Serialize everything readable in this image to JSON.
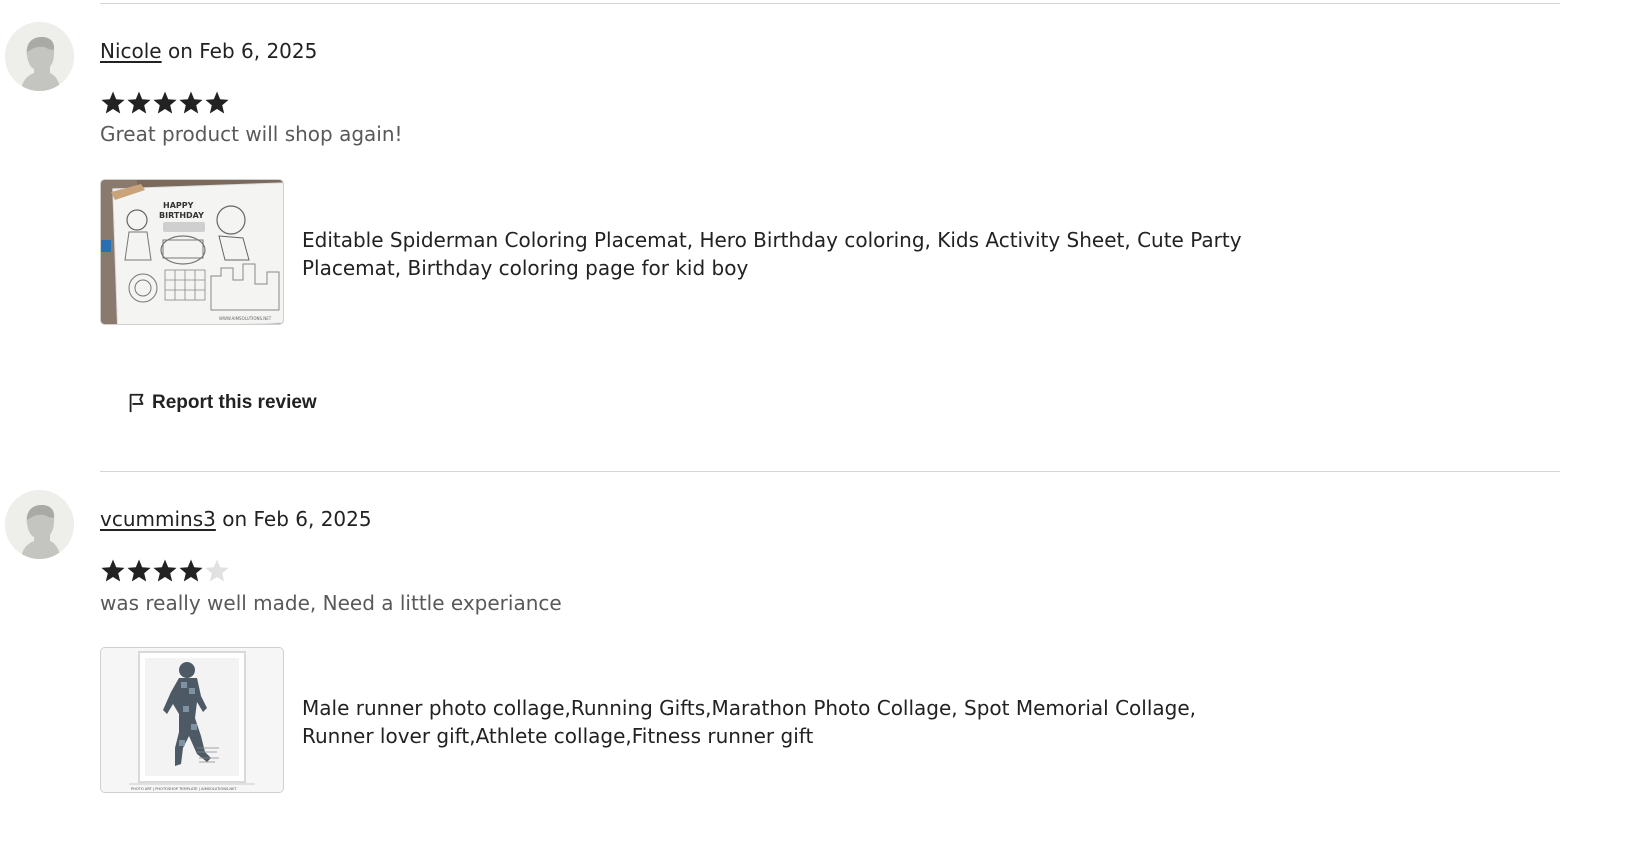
{
  "reviews": [
    {
      "username": "Nicole",
      "date_text": "on Feb 6, 2025",
      "rating": 5,
      "max_rating": 5,
      "text": "Great product will shop again!",
      "product_title": "Editable Spiderman Coloring Placemat, Hero Birthday coloring, Kids Activity Sheet, Cute Party Placemat, Birthday coloring page for kid boy",
      "thumbnail": {
        "happy": "HAPPY",
        "birthday": "BIRTHDAY",
        "site": "WWW.AIMSOLUTIONS.NET"
      },
      "report_label": "Report this review"
    },
    {
      "username": "vcummins3",
      "date_text": "on Feb 6, 2025",
      "rating": 4,
      "max_rating": 5,
      "text": "was really well made, Need a little experiance",
      "product_title": "Male runner photo collage,Running Gifts,Marathon Photo Collage, Spot Memorial Collage, Runner lover gift,Athlete collage,Fitness runner gift",
      "thumbnail": {
        "footer": "PHOTO ART | PHOTOSHOP TEMPLATE | AIMSOLUTIONS.NET"
      }
    }
  ],
  "icons": {
    "avatar": "default-user-avatar-icon",
    "star_filled": "star-filled-icon",
    "star_empty": "star-empty-icon",
    "flag": "flag-icon"
  },
  "colors": {
    "text": "#222222",
    "muted_text": "#595959",
    "star_filled": "#222222",
    "star_empty": "#e1e1e1",
    "divider": "#d6d6d6"
  }
}
